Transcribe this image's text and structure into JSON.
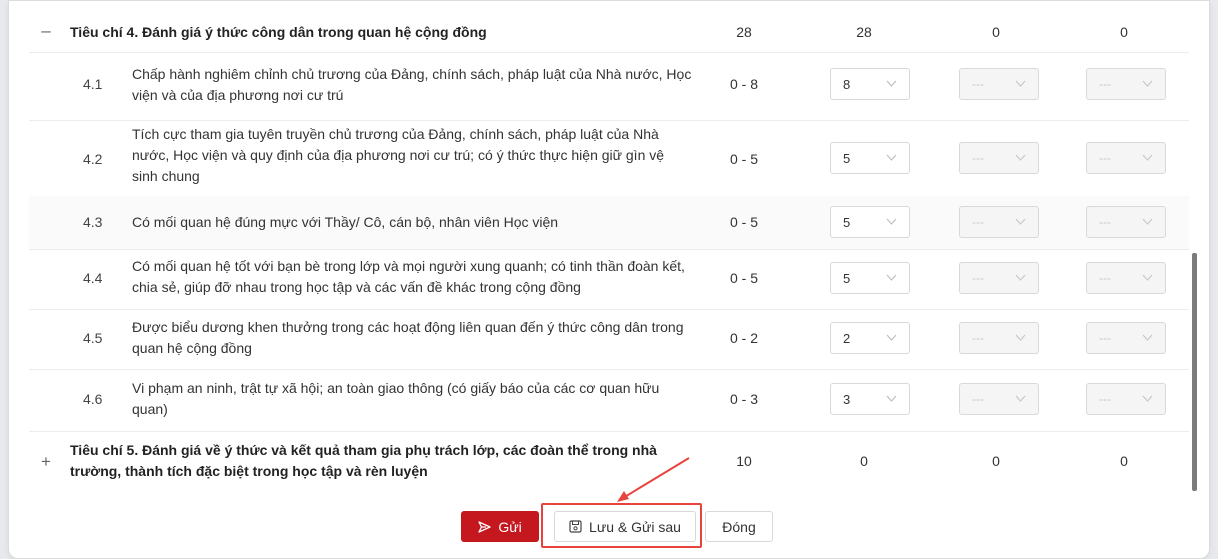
{
  "criterion4": {
    "toggle": "–",
    "title": "Tiêu chí 4. Đánh giá ý thức công dân trong quan hệ cộng đồng",
    "max": "28",
    "self": "28",
    "class": "0",
    "faculty": "0"
  },
  "items": [
    {
      "num": "4.1",
      "text": "Chấp hành nghiêm chỉnh chủ trương của Đảng, chính sách, pháp luật của Nhà nước, Học viện và của địa phương nơi cư trú",
      "range": "0 - 8",
      "score": "8",
      "c2": "---",
      "c3": "---"
    },
    {
      "num": "4.2",
      "text": "Tích cực tham gia tuyên truyền chủ trương của Đảng, chính sách, pháp luật của Nhà nước, Học viện và quy định của địa phương nơi cư trú; có ý thức thực hiện giữ gìn vệ sinh chung",
      "range": "0 - 5",
      "score": "5",
      "c2": "---",
      "c3": "---"
    },
    {
      "num": "4.3",
      "text": "Có mối quan hệ đúng mực với Thầy/ Cô, cán bộ, nhân viên Học viện",
      "range": "0 - 5",
      "score": "5",
      "c2": "---",
      "c3": "---"
    },
    {
      "num": "4.4",
      "text": "Có mối quan hệ tốt với bạn bè trong lớp và mọi người xung quanh; có tinh thần đoàn kết, chia sẻ, giúp đỡ nhau trong học tập và các vấn đề khác trong cộng đồng",
      "range": "0 - 5",
      "score": "5",
      "c2": "---",
      "c3": "---"
    },
    {
      "num": "4.5",
      "text": "Được biểu dương khen thưởng trong các hoạt động liên quan đến ý thức công dân trong quan hệ cộng đồng",
      "range": "0 - 2",
      "score": "2",
      "c2": "---",
      "c3": "---"
    },
    {
      "num": "4.6",
      "text": "Vi phạm an ninh, trật tự xã hội; an toàn giao thông (có giấy báo của các cơ quan hữu quan)",
      "range": "0 - 3",
      "score": "3",
      "c2": "---",
      "c3": "---"
    }
  ],
  "criterion5": {
    "toggle": "+",
    "title": "Tiêu chí 5. Đánh giá về ý thức và kết quả tham gia phụ trách lớp, các đoàn thể trong nhà trường, thành tích đặc biệt trong học tập và rèn luyện",
    "max": "10",
    "self": "0",
    "class": "0",
    "faculty": "0"
  },
  "buttons": {
    "send": "Gửi",
    "save": "Lưu & Gửi sau",
    "close": "Đóng"
  },
  "colors": {
    "primary": "#c4171e",
    "highlight": "#e8433d"
  }
}
